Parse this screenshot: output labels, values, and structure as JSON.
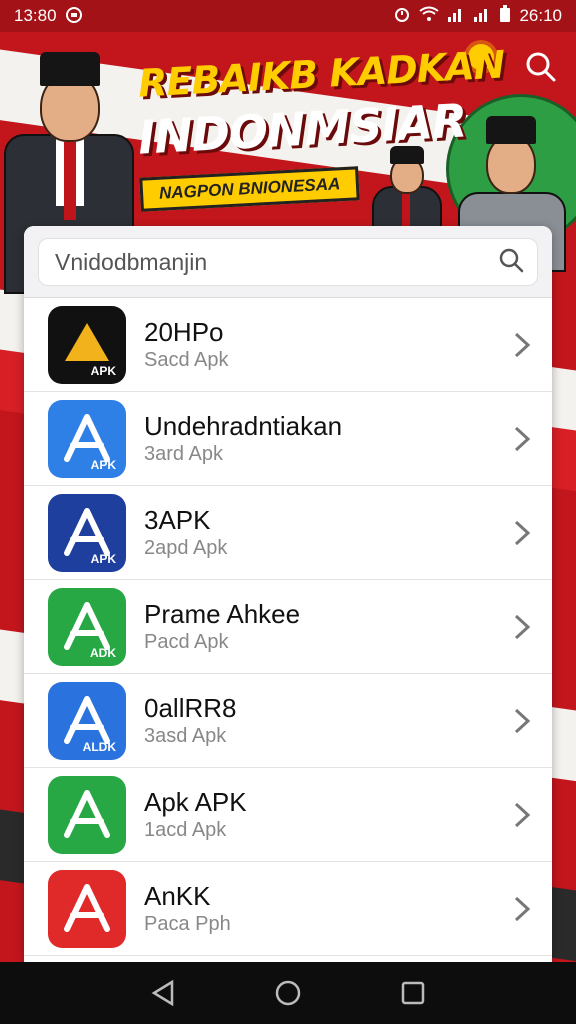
{
  "status_bar": {
    "time": "13:80",
    "clock_right": "26:10"
  },
  "banner": {
    "title_line1": "REBAIKB KADKAN",
    "title_line2": "INDONMSIAR",
    "ribbon": "NAGPON BNIONESAA"
  },
  "search": {
    "placeholder": "Vnidodbmanjin",
    "value": "Vnidodbmanjin"
  },
  "apps": [
    {
      "title": "20HPo",
      "subtitle": "Sacd Apk",
      "icon_bg": "#111111",
      "icon_fg": "#f2b21b",
      "icon_label": "APK"
    },
    {
      "title": "Undehradntiakan",
      "subtitle": "3ard Apk",
      "icon_bg": "#2f80e6",
      "icon_fg": "#ffffff",
      "icon_label": "APK"
    },
    {
      "title": "3APK",
      "subtitle": "2apd Apk",
      "icon_bg": "#1f3f9e",
      "icon_fg": "#ffffff",
      "icon_label": "APK"
    },
    {
      "title": "Prame Ahkee",
      "subtitle": "Pacd Apk",
      "icon_bg": "#27a845",
      "icon_fg": "#ffffff",
      "icon_label": "ADK"
    },
    {
      "title": "0allRR8",
      "subtitle": "3asd Apk",
      "icon_bg": "#2a73de",
      "icon_fg": "#ffffff",
      "icon_label": "ALDK"
    },
    {
      "title": "Apk APK",
      "subtitle": "1acd Apk",
      "icon_bg": "#27a845",
      "icon_fg": "#ffffff",
      "icon_label": ""
    },
    {
      "title": "AnKK",
      "subtitle": "Paca Pph",
      "icon_bg": "#e02a2a",
      "icon_fg": "#ffffff",
      "icon_label": ""
    }
  ],
  "colors": {
    "banner_red": "#c3161c",
    "accent_yellow": "#ffcc00"
  }
}
